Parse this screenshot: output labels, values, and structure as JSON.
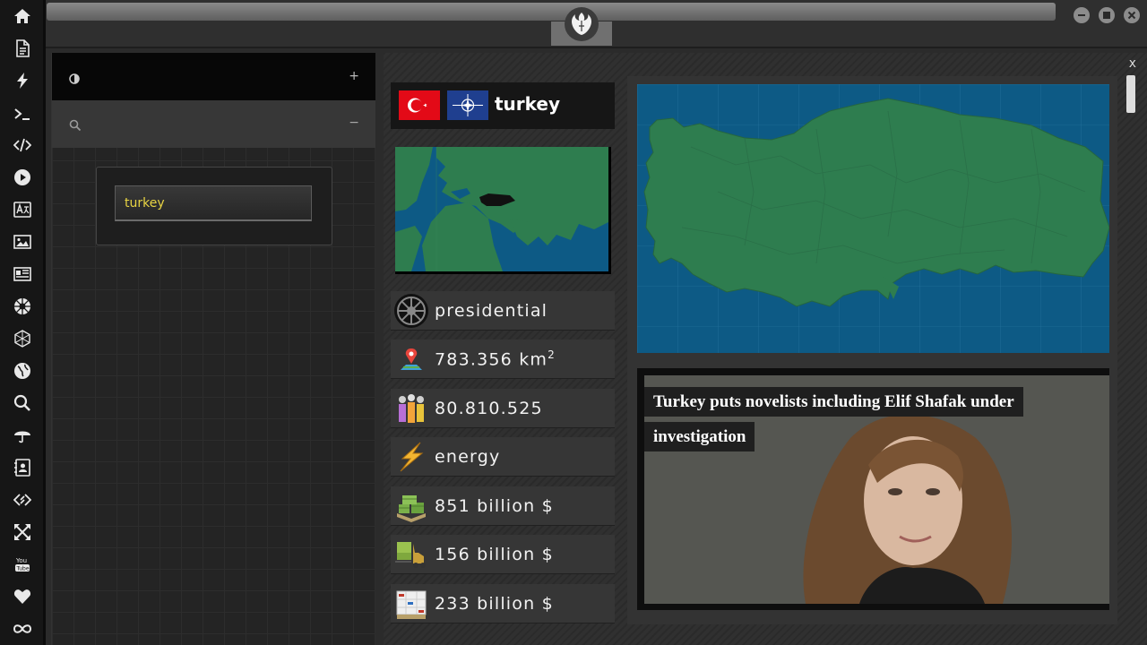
{
  "left_panel": {
    "search_value": "turkey",
    "row1_button": "+",
    "row2_button": "−"
  },
  "main": {
    "close_label": "x",
    "country": {
      "name": "turkey",
      "flags": [
        "flag-turkey-icon",
        "flag-nato-icon"
      ]
    },
    "stats": [
      {
        "icon": "imperial-emblem-icon",
        "value": "presidential"
      },
      {
        "icon": "map-pin-icon",
        "value": "783.356 km",
        "sup": "2"
      },
      {
        "icon": "population-icon",
        "value": "80.810.525"
      },
      {
        "icon": "lightning-icon",
        "value": "energy"
      },
      {
        "icon": "money-stack-icon",
        "value": "851 billion $"
      },
      {
        "icon": "export-forklift-icon",
        "value": "156 billion $"
      },
      {
        "icon": "import-boxes-icon",
        "value": "233 billion $"
      }
    ],
    "news": {
      "headline": "Turkey puts novelists including Elif Shafak under investigation"
    }
  },
  "colors": {
    "land": "#2e7d4f",
    "sea": "#0d5a85",
    "highlight_country": "#111111",
    "search_text": "#e8d443"
  }
}
